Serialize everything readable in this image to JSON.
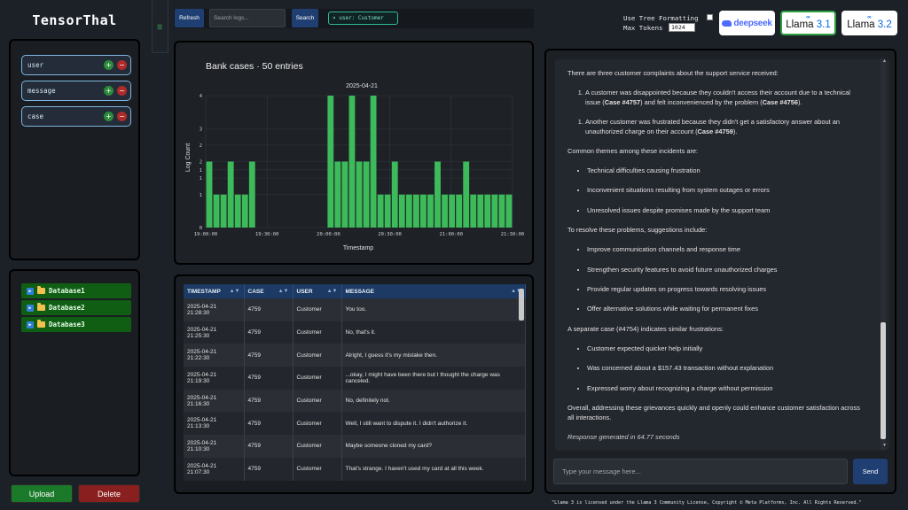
{
  "app": {
    "title": "TensorThal"
  },
  "sidebar": {
    "fields": [
      {
        "label": "user"
      },
      {
        "label": "message"
      },
      {
        "label": "case"
      }
    ],
    "databases": [
      {
        "label": "Database1"
      },
      {
        "label": "Database2"
      },
      {
        "label": "Database3"
      }
    ],
    "upload_label": "Upload",
    "delete_label": "Delete",
    "handle_icon": "drag-handle-icon"
  },
  "toolbar": {
    "refresh_label": "Refresh",
    "search_placeholder": "Search logs...",
    "search_label": "Search",
    "filter_chip": "× user: Customer"
  },
  "settings": {
    "tree_formatting_label": "Use Tree Formatting",
    "tree_formatting_checked": false,
    "max_tokens_label": "Max Tokens",
    "max_tokens_value": "1024"
  },
  "models": [
    {
      "name": "deepseek",
      "selected": false
    },
    {
      "name": "Llama 3.1",
      "selected": true,
      "prefix": "Llama",
      "version": "3.1",
      "brand": "Meta"
    },
    {
      "name": "Llama 3.2",
      "selected": false,
      "prefix": "Llama",
      "version": "3.2",
      "brand": "Meta"
    }
  ],
  "chart_data": {
    "type": "bar",
    "title": "Bank cases · 50 entries",
    "subtitle": "2025-04-21",
    "xlabel": "Timestamp",
    "ylabel": "Log Count",
    "ylim": [
      0,
      4
    ],
    "yticks": [
      "0",
      "1",
      "1",
      "1",
      "2",
      "2",
      "3",
      "4"
    ],
    "ytick_values": [
      0,
      1,
      1.5,
      1.75,
      2,
      2.5,
      3,
      4
    ],
    "xticks": [
      "19:00:00",
      "19:30:00",
      "20:00:00",
      "20:30:00",
      "21:00:00",
      "21:30:00"
    ],
    "x_start_label": "19:00:00",
    "x_end_label": "21:30:00",
    "bar_color": "#3dbb5a",
    "grid": true,
    "bars": [
      {
        "t": 0,
        "v": 2
      },
      {
        "t": 1,
        "v": 1
      },
      {
        "t": 2,
        "v": 1
      },
      {
        "t": 3,
        "v": 2
      },
      {
        "t": 4,
        "v": 1
      },
      {
        "t": 5,
        "v": 1
      },
      {
        "t": 6,
        "v": 2
      },
      {
        "t": 17,
        "v": 4
      },
      {
        "t": 18,
        "v": 2
      },
      {
        "t": 19,
        "v": 2
      },
      {
        "t": 20,
        "v": 4
      },
      {
        "t": 21,
        "v": 2
      },
      {
        "t": 22,
        "v": 2
      },
      {
        "t": 23,
        "v": 4
      },
      {
        "t": 24,
        "v": 1
      },
      {
        "t": 25,
        "v": 1
      },
      {
        "t": 26,
        "v": 2
      },
      {
        "t": 27,
        "v": 1
      },
      {
        "t": 28,
        "v": 1
      },
      {
        "t": 29,
        "v": 1
      },
      {
        "t": 30,
        "v": 1
      },
      {
        "t": 31,
        "v": 1
      },
      {
        "t": 32,
        "v": 2
      },
      {
        "t": 33,
        "v": 1
      },
      {
        "t": 34,
        "v": 1
      },
      {
        "t": 35,
        "v": 1
      },
      {
        "t": 36,
        "v": 2
      },
      {
        "t": 37,
        "v": 1
      },
      {
        "t": 38,
        "v": 1
      },
      {
        "t": 39,
        "v": 1
      },
      {
        "t": 40,
        "v": 1
      },
      {
        "t": 41,
        "v": 1
      },
      {
        "t": 42,
        "v": 1
      }
    ],
    "slots": 43
  },
  "table": {
    "columns": [
      "TIMESTAMP",
      "CASE",
      "USER",
      "MESSAGE"
    ],
    "rows": [
      {
        "timestamp": "2025-04-21 21:28:30",
        "case": "4759",
        "user": "Customer",
        "message": "You too."
      },
      {
        "timestamp": "2025-04-21 21:25:30",
        "case": "4759",
        "user": "Customer",
        "message": "No, that's it."
      },
      {
        "timestamp": "2025-04-21 21:22:30",
        "case": "4759",
        "user": "Customer",
        "message": "Alright, I guess it's my mistake then."
      },
      {
        "timestamp": "2025-04-21 21:19:30",
        "case": "4759",
        "user": "Customer",
        "message": "...okay, I might have been there but I thought the charge was canceled."
      },
      {
        "timestamp": "2025-04-21 21:16:30",
        "case": "4759",
        "user": "Customer",
        "message": "No, definitely not."
      },
      {
        "timestamp": "2025-04-21 21:13:30",
        "case": "4759",
        "user": "Customer",
        "message": "Well, I still want to dispute it. I didn't authorize it."
      },
      {
        "timestamp": "2025-04-21 21:10:30",
        "case": "4759",
        "user": "Customer",
        "message": "Maybe someone cloned my card?"
      },
      {
        "timestamp": "2025-04-21 21:07:30",
        "case": "4759",
        "user": "Customer",
        "message": "That's strange. I haven't used my card at all this week."
      }
    ]
  },
  "chat": {
    "intro": "There are three customer complaints about the support service received:",
    "complaint_1_pre": "A customer was disappointed because they couldn't access their account due to a technical issue (",
    "complaint_1_case_a": "Case #4757",
    "complaint_1_mid": ") and felt inconvenienced by the problem (",
    "complaint_1_case_b": "Case #4756",
    "complaint_1_post": ").",
    "complaint_2_pre": "Another customer was frustrated because they didn't get a satisfactory answer about an unauthorized charge on their account (",
    "complaint_2_case": "Case #4759",
    "complaint_2_post": ").",
    "themes_heading": "Common themes among these incidents are:",
    "themes": [
      "Technical difficulties causing frustration",
      "Inconvenient situations resulting from system outages or errors",
      "Unresolved issues despite promises made by the support team"
    ],
    "suggestions_heading": "To resolve these problems, suggestions include:",
    "suggestions": [
      "Improve communication channels and response time",
      "Strengthen security features to avoid future unauthorized charges",
      "Provide regular updates on progress towards resolving issues",
      "Offer alternative solutions while waiting for permanent fixes"
    ],
    "separate_heading": "A separate case (#4754) indicates similar frustrations:",
    "separate_items": [
      "Customer expected quicker help initially",
      "Was concerned about a $157.43 transaction without explanation",
      "Expressed worry about recognizing a charge without permission"
    ],
    "conclusion": "Overall, addressing these grievances quickly and openly could enhance customer satisfaction across all interactions.",
    "response_time": "Response generated in 64.77 seconds",
    "input_placeholder": "Type your message here...",
    "send_label": "Send"
  },
  "footer": {
    "license": "\"Llama 3 is licensed under the Llama 3 Community License, Copyright © Meta Platforms, Inc. All Rights Reserved.\""
  }
}
